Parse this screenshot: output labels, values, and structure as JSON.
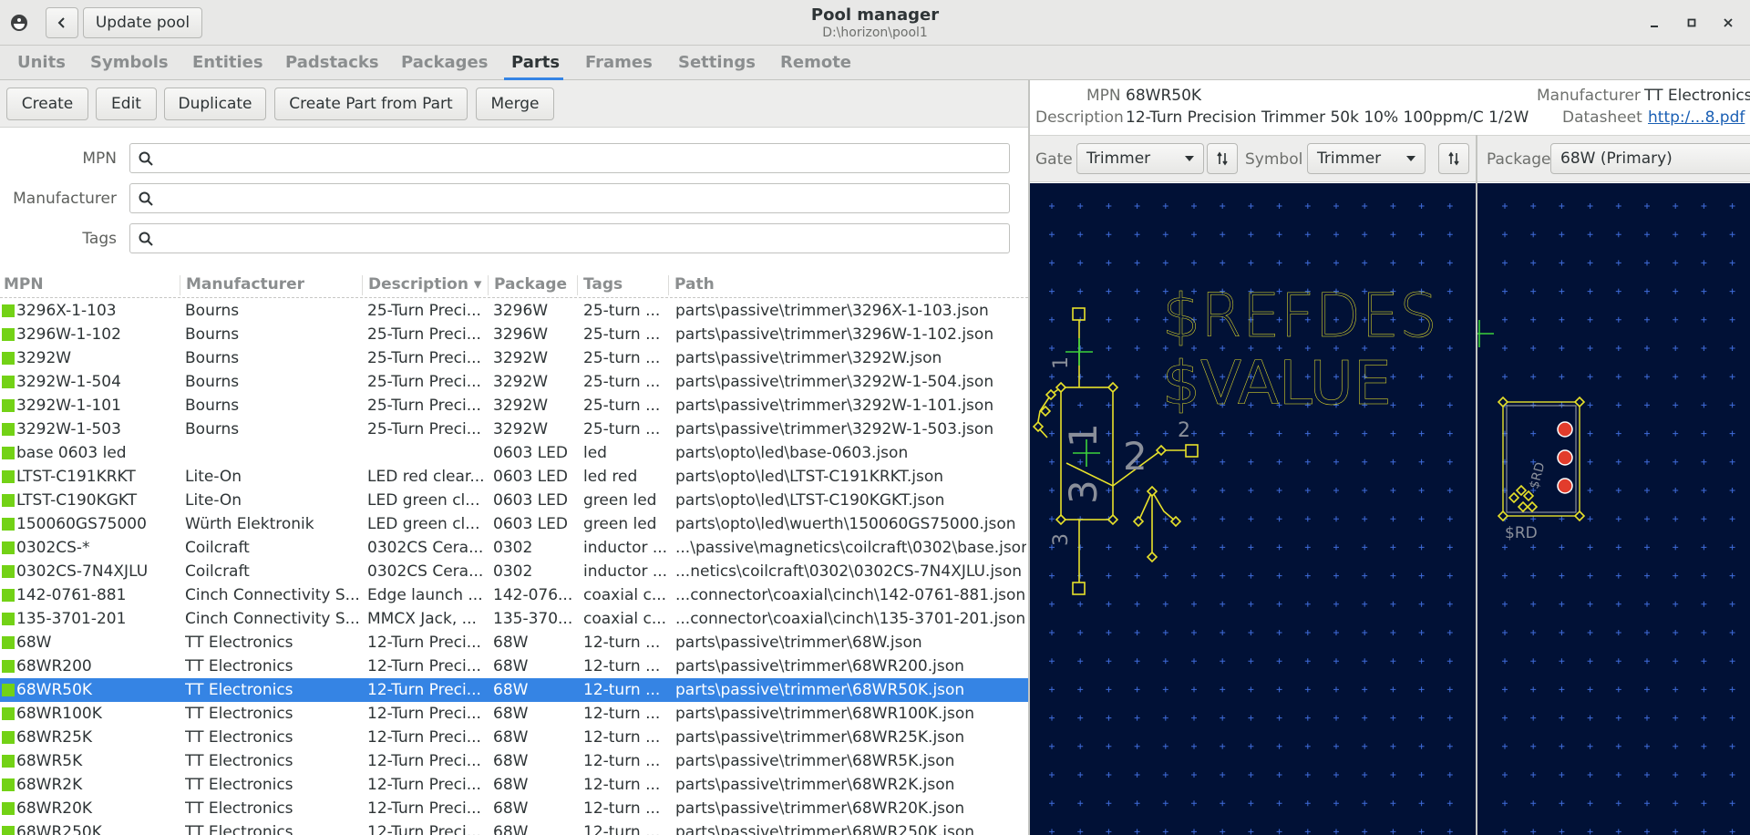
{
  "window": {
    "title": "Pool manager",
    "subtitle": "D:\\horizon\\pool1",
    "update_pool_label": "Update pool"
  },
  "tabs": [
    {
      "label": "Units",
      "active": false
    },
    {
      "label": "Symbols",
      "active": false
    },
    {
      "label": "Entities",
      "active": false
    },
    {
      "label": "Padstacks",
      "active": false
    },
    {
      "label": "Packages",
      "active": false
    },
    {
      "label": "Parts",
      "active": true
    },
    {
      "label": "Frames",
      "active": false
    },
    {
      "label": "Settings",
      "active": false
    },
    {
      "label": "Remote",
      "active": false
    }
  ],
  "toolbar": {
    "create_label": "Create",
    "edit_label": "Edit",
    "duplicate_label": "Duplicate",
    "create_from_part_label": "Create Part from Part",
    "merge_label": "Merge"
  },
  "filters": {
    "mpn_label": "MPN",
    "mpn_value": "",
    "manufacturer_label": "Manufacturer",
    "manufacturer_value": "",
    "tags_label": "Tags",
    "tags_value": ""
  },
  "table": {
    "columns": [
      "MPN",
      "Manufacturer",
      "Description",
      "Package",
      "Tags",
      "Path"
    ],
    "sort_indicator": "▾",
    "rows": [
      {
        "mpn": "3296X-1-103",
        "manufacturer": "Bourns",
        "description": "25-Turn Preci...",
        "package": "3296W",
        "tags": "25-turn ...",
        "path": "parts\\passive\\trimmer\\3296X-1-103.json",
        "selected": false
      },
      {
        "mpn": "3296W-1-102",
        "manufacturer": "Bourns",
        "description": "25-Turn Preci...",
        "package": "3296W",
        "tags": "25-turn ...",
        "path": "parts\\passive\\trimmer\\3296W-1-102.json",
        "selected": false
      },
      {
        "mpn": "3292W",
        "manufacturer": "Bourns",
        "description": "25-Turn Preci...",
        "package": "3292W",
        "tags": "25-turn ...",
        "path": "parts\\passive\\trimmer\\3292W.json",
        "selected": false
      },
      {
        "mpn": "3292W-1-504",
        "manufacturer": "Bourns",
        "description": "25-Turn Preci...",
        "package": "3292W",
        "tags": "25-turn ...",
        "path": "parts\\passive\\trimmer\\3292W-1-504.json",
        "selected": false
      },
      {
        "mpn": "3292W-1-101",
        "manufacturer": "Bourns",
        "description": "25-Turn Preci...",
        "package": "3292W",
        "tags": "25-turn ...",
        "path": "parts\\passive\\trimmer\\3292W-1-101.json",
        "selected": false
      },
      {
        "mpn": "3292W-1-503",
        "manufacturer": "Bourns",
        "description": "25-Turn Preci...",
        "package": "3292W",
        "tags": "25-turn ...",
        "path": "parts\\passive\\trimmer\\3292W-1-503.json",
        "selected": false
      },
      {
        "mpn": "base 0603 led",
        "manufacturer": "",
        "description": "",
        "package": "0603 LED",
        "tags": "led",
        "path": "parts\\opto\\led\\base-0603.json",
        "selected": false
      },
      {
        "mpn": "LTST-C191KRKT",
        "manufacturer": "Lite-On",
        "description": "LED red clear...",
        "package": "0603 LED",
        "tags": "led red",
        "path": "parts\\opto\\led\\LTST-C191KRKT.json",
        "selected": false
      },
      {
        "mpn": "LTST-C190KGKT",
        "manufacturer": "Lite-On",
        "description": "LED green cl...",
        "package": "0603 LED",
        "tags": "green led",
        "path": "parts\\opto\\led\\LTST-C190KGKT.json",
        "selected": false
      },
      {
        "mpn": "150060GS75000",
        "manufacturer": "Würth Elektronik",
        "description": "LED green cl...",
        "package": "0603 LED",
        "tags": "green led",
        "path": "parts\\opto\\led\\wuerth\\150060GS75000.json",
        "selected": false
      },
      {
        "mpn": "0302CS-*",
        "manufacturer": "Coilcraft",
        "description": "0302CS Cera...",
        "package": "0302",
        "tags": "inductor ...",
        "path": "...\\passive\\magnetics\\coilcraft\\0302\\base.json",
        "selected": false
      },
      {
        "mpn": "0302CS-7N4XJLU",
        "manufacturer": "Coilcraft",
        "description": "0302CS Cera...",
        "package": "0302",
        "tags": "inductor ...",
        "path": "...netics\\coilcraft\\0302\\0302CS-7N4XJLU.json",
        "selected": false
      },
      {
        "mpn": "142-0761-881",
        "manufacturer": "Cinch Connectivity S...",
        "description": "Edge launch ...",
        "package": "142-076...",
        "tags": "coaxial c...",
        "path": "...connector\\coaxial\\cinch\\142-0761-881.json",
        "selected": false
      },
      {
        "mpn": "135-3701-201",
        "manufacturer": "Cinch Connectivity S...",
        "description": "MMCX Jack, ...",
        "package": "135-370...",
        "tags": "coaxial c...",
        "path": "...connector\\coaxial\\cinch\\135-3701-201.json",
        "selected": false
      },
      {
        "mpn": "68W",
        "manufacturer": "TT Electronics",
        "description": "12-Turn Preci...",
        "package": "68W",
        "tags": "12-turn ...",
        "path": "parts\\passive\\trimmer\\68W.json",
        "selected": false
      },
      {
        "mpn": "68WR200",
        "manufacturer": "TT Electronics",
        "description": "12-Turn Preci...",
        "package": "68W",
        "tags": "12-turn ...",
        "path": "parts\\passive\\trimmer\\68WR200.json",
        "selected": false
      },
      {
        "mpn": "68WR50K",
        "manufacturer": "TT Electronics",
        "description": "12-Turn Preci...",
        "package": "68W",
        "tags": "12-turn ...",
        "path": "parts\\passive\\trimmer\\68WR50K.json",
        "selected": true
      },
      {
        "mpn": "68WR100K",
        "manufacturer": "TT Electronics",
        "description": "12-Turn Preci...",
        "package": "68W",
        "tags": "12-turn ...",
        "path": "parts\\passive\\trimmer\\68WR100K.json",
        "selected": false
      },
      {
        "mpn": "68WR25K",
        "manufacturer": "TT Electronics",
        "description": "12-Turn Preci...",
        "package": "68W",
        "tags": "12-turn ...",
        "path": "parts\\passive\\trimmer\\68WR25K.json",
        "selected": false
      },
      {
        "mpn": "68WR5K",
        "manufacturer": "TT Electronics",
        "description": "12-Turn Preci...",
        "package": "68W",
        "tags": "12-turn ...",
        "path": "parts\\passive\\trimmer\\68WR5K.json",
        "selected": false
      },
      {
        "mpn": "68WR2K",
        "manufacturer": "TT Electronics",
        "description": "12-Turn Preci...",
        "package": "68W",
        "tags": "12-turn ...",
        "path": "parts\\passive\\trimmer\\68WR2K.json",
        "selected": false
      },
      {
        "mpn": "68WR20K",
        "manufacturer": "TT Electronics",
        "description": "12-Turn Preci...",
        "package": "68W",
        "tags": "12-turn ...",
        "path": "parts\\passive\\trimmer\\68WR20K.json",
        "selected": false
      },
      {
        "mpn": "68WR250K",
        "manufacturer": "TT Electronics",
        "description": "12-Turn Preci...",
        "package": "68W",
        "tags": "12-turn ...",
        "path": "parts\\passive\\trimmer\\68WR250K.json",
        "selected": false
      }
    ]
  },
  "detail": {
    "mpn_label": "MPN",
    "mpn_value": "68WR50K",
    "manufacturer_label": "Manufacturer",
    "manufacturer_value": "TT Electronics",
    "description_label": "Description",
    "description_value": "12-Turn Precision Trimmer 50k 10% 100ppm/C 1/2W",
    "datasheet_label": "Datasheet",
    "datasheet_link": "http:/...8.pdf",
    "gate_label": "Gate",
    "gate_value": "Trimmer",
    "symbol_label": "Symbol",
    "symbol_value": "Trimmer",
    "package_label": "Package",
    "package_value": "68W (Primary)"
  },
  "symbol_preview": {
    "refdes_text": "$REFDES",
    "value_text": "$VALUE",
    "pin_1": "1",
    "pin_2": "2",
    "pin_3": "3",
    "body_labels": [
      "1",
      "2",
      "3"
    ]
  },
  "package_preview": {
    "refdes_text": "$RD",
    "silk_text": "$RD"
  },
  "colors": {
    "canvas_bg": "#011136",
    "grid": "#3f6bd9",
    "symbol_line": "#e8e22a",
    "origin_marker": "#3cd23c",
    "pad_fill": "#e23c2c",
    "selection": "#3584e4",
    "swatch": "#73d216"
  }
}
